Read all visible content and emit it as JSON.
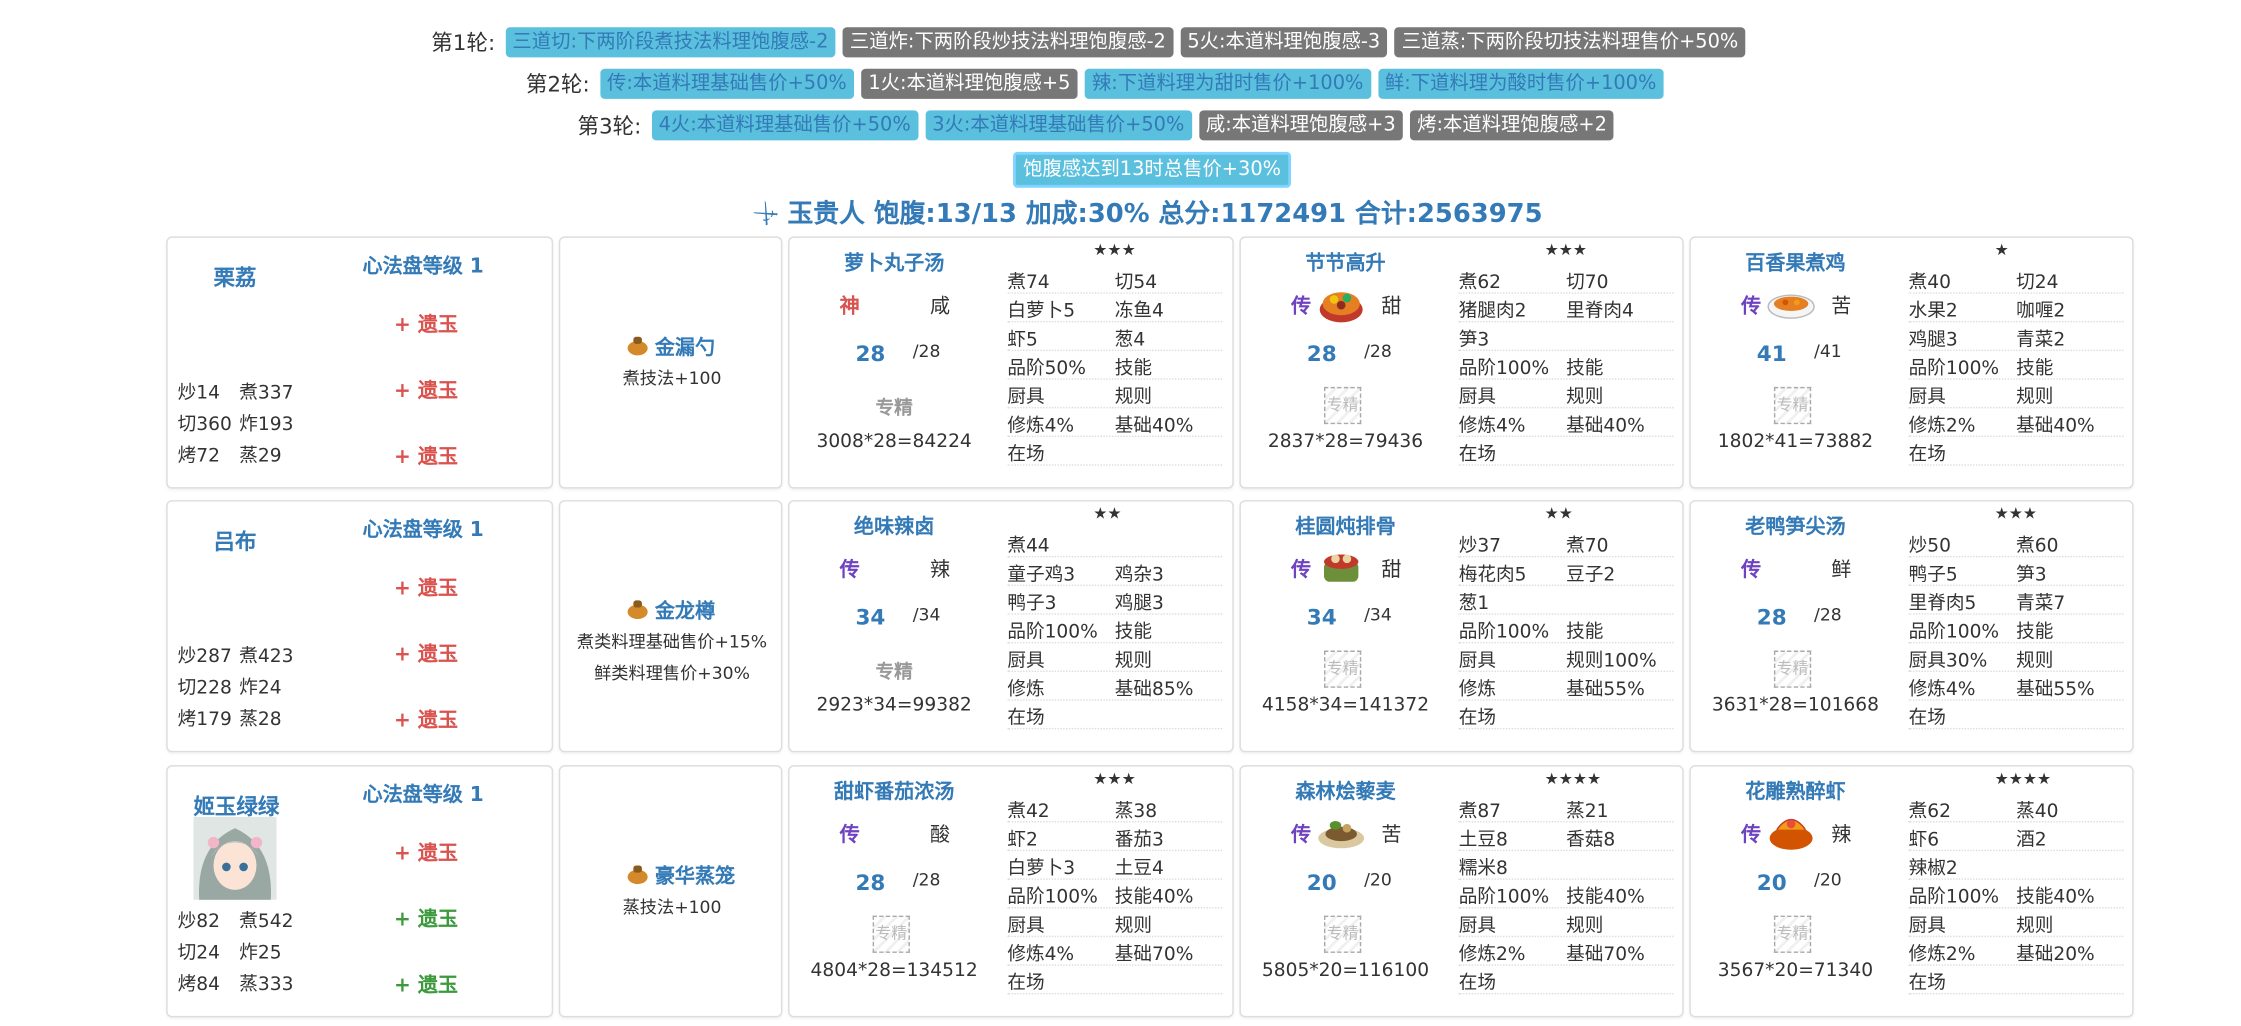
{
  "rounds": [
    {
      "label": "第1轮:",
      "tags": [
        {
          "text": "三道切:下两阶段煮技法料理饱腹感-2",
          "color": "blue"
        },
        {
          "text": "三道炸:下两阶段炒技法料理饱腹感-2",
          "color": "gray"
        },
        {
          "text": "5火:本道料理饱腹感-3",
          "color": "gray"
        },
        {
          "text": "三道蒸:下两阶段切技法料理售价+50%",
          "color": "gray"
        }
      ]
    },
    {
      "label": "第2轮:",
      "tags": [
        {
          "text": "传:本道料理基础售价+50%",
          "color": "blue"
        },
        {
          "text": "1火:本道料理饱腹感+5",
          "color": "gray"
        },
        {
          "text": "辣:下道料理为甜时售价+100%",
          "color": "blue"
        },
        {
          "text": "鲜:下道料理为酸时售价+100%",
          "color": "blue"
        }
      ]
    },
    {
      "label": "第3轮:",
      "tags": [
        {
          "text": "4火:本道料理基础售价+50%",
          "color": "blue"
        },
        {
          "text": "3火:本道料理基础售价+50%",
          "color": "blue"
        },
        {
          "text": "咸:本道料理饱腹感+3",
          "color": "gray"
        },
        {
          "text": "烤:本道料理饱腹感+2",
          "color": "gray"
        }
      ]
    }
  ],
  "satiety_bonus": "饱腹感达到13时总售价+30%",
  "summary": {
    "icon": "sword-icon",
    "text": "玉贵人 饱腹:13/13 加成:30% 总分:1172491 合计:2563975"
  },
  "rows": [
    {
      "chef": {
        "name": "栗荔",
        "level": "心法盘等级 1",
        "jade": [
          {
            "text": "+ 遗玉",
            "color": "red"
          },
          {
            "text": "+ 遗玉",
            "color": "red"
          },
          {
            "text": "+ 遗玉",
            "color": "red"
          }
        ],
        "stats": [
          [
            "炒14",
            "煮337"
          ],
          [
            "切360",
            "炸193"
          ],
          [
            "烤72",
            "蒸29"
          ]
        ],
        "avatar": false
      },
      "tool": {
        "icon": "ladle-icon",
        "name": "金漏勺",
        "desc": [
          "煮技法+100"
        ]
      },
      "dishes": [
        {
          "name": "萝卜丸子汤",
          "stars": "★★★",
          "rank": "神",
          "taste": "咸",
          "qty": "28",
          "max": "/28",
          "cert": "专精",
          "cert_icon": false,
          "total": "3008*28=84224",
          "img": false,
          "info": [
            [
              "煮74",
              "切54"
            ],
            [
              "白萝卜5",
              "冻鱼4"
            ],
            [
              "虾5",
              "葱4"
            ],
            [
              "品阶50%",
              "技能"
            ],
            [
              "厨具",
              "规则"
            ],
            [
              "修炼4%",
              "基础40%"
            ],
            [
              "在场",
              ""
            ]
          ]
        },
        {
          "name": "节节高升",
          "stars": "★★★",
          "rank": "传",
          "taste": "甜",
          "qty": "28",
          "max": "/28",
          "cert": "专精",
          "cert_icon": true,
          "total": "2837*28=79436",
          "img": "stew",
          "info": [
            [
              "煮62",
              "切70"
            ],
            [
              "猪腿肉2",
              "里脊肉4"
            ],
            [
              "笋3",
              ""
            ],
            [
              "品阶100%",
              "技能"
            ],
            [
              "厨具",
              "规则"
            ],
            [
              "修炼4%",
              "基础40%"
            ],
            [
              "在场",
              ""
            ]
          ]
        },
        {
          "name": "百香果煮鸡",
          "stars": "★",
          "rank": "传",
          "taste": "苦",
          "qty": "41",
          "max": "/41",
          "cert": "专精",
          "cert_icon": true,
          "total": "1802*41=73882",
          "img": "bowl",
          "info": [
            [
              "煮40",
              "切24"
            ],
            [
              "水果2",
              "咖喱2"
            ],
            [
              "鸡腿3",
              "青菜2"
            ],
            [
              "品阶100%",
              "技能"
            ],
            [
              "厨具",
              "规则"
            ],
            [
              "修炼2%",
              "基础40%"
            ],
            [
              "在场",
              ""
            ]
          ]
        }
      ]
    },
    {
      "chef": {
        "name": "吕布",
        "level": "心法盘等级 1",
        "jade": [
          {
            "text": "+ 遗玉",
            "color": "red"
          },
          {
            "text": "+ 遗玉",
            "color": "red"
          },
          {
            "text": "+ 遗玉",
            "color": "red"
          }
        ],
        "stats": [
          [
            "炒287",
            "煮423"
          ],
          [
            "切228",
            "炸24"
          ],
          [
            "烤179",
            "蒸28"
          ]
        ],
        "avatar": false
      },
      "tool": {
        "icon": "cauldron-icon",
        "name": "金龙樽",
        "desc": [
          "煮类料理基础售价+15%",
          "鲜类料理售价+30%"
        ]
      },
      "dishes": [
        {
          "name": "绝味辣卤",
          "stars": "★★",
          "rank": "传",
          "taste": "辣",
          "qty": "34",
          "max": "/34",
          "cert": "专精",
          "cert_icon": false,
          "total": "2923*34=99382",
          "img": false,
          "info": [
            [
              "煮44",
              ""
            ],
            [
              "童子鸡3",
              "鸡杂3"
            ],
            [
              "鸭子3",
              "鸡腿3"
            ],
            [
              "品阶100%",
              "技能"
            ],
            [
              "厨具",
              "规则"
            ],
            [
              "修炼",
              "基础85%"
            ],
            [
              "在场",
              ""
            ]
          ]
        },
        {
          "name": "桂圆炖排骨",
          "stars": "★★",
          "rank": "传",
          "taste": "甜",
          "qty": "34",
          "max": "/34",
          "cert": "专精",
          "cert_icon": true,
          "total": "4158*34=141372",
          "img": "pot",
          "info": [
            [
              "炒37",
              "煮70"
            ],
            [
              "梅花肉5",
              "豆子2"
            ],
            [
              "葱1",
              ""
            ],
            [
              "品阶100%",
              "技能"
            ],
            [
              "厨具",
              "规则100%"
            ],
            [
              "修炼",
              "基础55%"
            ],
            [
              "在场",
              ""
            ]
          ]
        },
        {
          "name": "老鸭笋尖汤",
          "stars": "★★★",
          "rank": "传",
          "taste": "鲜",
          "qty": "28",
          "max": "/28",
          "cert": "专精",
          "cert_icon": true,
          "total": "3631*28=101668",
          "img": false,
          "info": [
            [
              "炒50",
              "煮60"
            ],
            [
              "鸭子5",
              "笋3"
            ],
            [
              "里脊肉5",
              "青菜7"
            ],
            [
              "品阶100%",
              "技能"
            ],
            [
              "厨具30%",
              "规则"
            ],
            [
              "修炼4%",
              "基础55%"
            ],
            [
              "在场",
              ""
            ]
          ]
        }
      ]
    },
    {
      "chef": {
        "name": "姬玉绿绿",
        "level": "心法盘等级 1",
        "jade": [
          {
            "text": "+ 遗玉",
            "color": "red"
          },
          {
            "text": "+ 遗玉",
            "color": "green"
          },
          {
            "text": "+ 遗玉",
            "color": "green"
          }
        ],
        "stats": [
          [
            "炒82",
            "煮542"
          ],
          [
            "切24",
            "炸25"
          ],
          [
            "烤84",
            "蒸333"
          ]
        ],
        "avatar": true
      },
      "tool": {
        "icon": "steamer-icon",
        "name": "豪华蒸笼",
        "desc": [
          "蒸技法+100"
        ]
      },
      "dishes": [
        {
          "name": "甜虾番茄浓汤",
          "stars": "★★★",
          "rank": "传",
          "taste": "酸",
          "qty": "28",
          "max": "/28",
          "cert": "专精",
          "cert_icon": true,
          "total": "4804*28=134512",
          "img": false,
          "info": [
            [
              "煮42",
              "蒸38"
            ],
            [
              "虾2",
              "番茄3"
            ],
            [
              "白萝卜3",
              "土豆4"
            ],
            [
              "品阶100%",
              "技能40%"
            ],
            [
              "厨具",
              "规则"
            ],
            [
              "修炼4%",
              "基础70%"
            ],
            [
              "在场",
              ""
            ]
          ]
        },
        {
          "name": "森林烩藜麦",
          "stars": "★★★★",
          "rank": "传",
          "taste": "苦",
          "qty": "20",
          "max": "/20",
          "cert": "专精",
          "cert_icon": true,
          "total": "5805*20=116100",
          "img": "plate",
          "info": [
            [
              "煮87",
              "蒸21"
            ],
            [
              "土豆8",
              "香菇8"
            ],
            [
              "糯米8",
              ""
            ],
            [
              "品阶100%",
              "技能40%"
            ],
            [
              "厨具",
              "规则"
            ],
            [
              "修炼2%",
              "基础70%"
            ],
            [
              "在场",
              ""
            ]
          ]
        },
        {
          "name": "花雕熟醉虾",
          "stars": "★★★★",
          "rank": "传",
          "taste": "辣",
          "qty": "20",
          "max": "/20",
          "cert": "专精",
          "cert_icon": true,
          "total": "3567*20=71340",
          "img": "shrimp",
          "info": [
            [
              "煮62",
              "蒸40"
            ],
            [
              "虾6",
              "酒2"
            ],
            [
              "辣椒2",
              ""
            ],
            [
              "品阶100%",
              "技能40%"
            ],
            [
              "厨具",
              "规则"
            ],
            [
              "修炼2%",
              "基础20%"
            ],
            [
              "在场",
              ""
            ]
          ]
        }
      ]
    }
  ]
}
